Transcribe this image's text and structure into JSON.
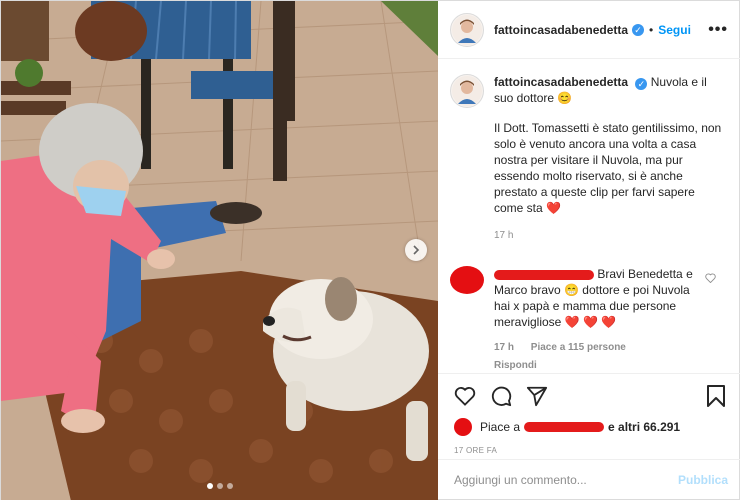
{
  "post": {
    "username": "fattoincasadabenedetta",
    "follow_label": "Segui",
    "more_label": "•••",
    "separator": "•"
  },
  "caption": {
    "username": "fattoincasadabenedetta",
    "title": "Nuvola e il suo dottore 😊",
    "text": "Il Dott. Tomassetti è stato gentilissimo, non solo è venuto ancora una volta a casa nostra per visitare il Nuvola, ma pur essendo molto riservato, si è anche prestato a queste clip per farvi sapere come sta ❤️",
    "time": "17 h"
  },
  "comment": {
    "text": "Bravi Benedetta e Marco bravo 😁 dottore e poi Nuvola hai x papà e mamma due persone meravigliose ❤️ ❤️ ❤️",
    "time": "17 h",
    "likes": "Piace a 115 persone",
    "reply": "Rispondi"
  },
  "likes": {
    "prefix": "Piace a",
    "suffix": "e altri 66.291"
  },
  "date": "17 ORE FA",
  "add_comment": {
    "placeholder": "Aggiungi un commento...",
    "publish_label": "Pubblica"
  },
  "carousel": {
    "count": 3,
    "active": 0
  },
  "colors": {
    "accent": "#0095f6",
    "verified": "#3897f0",
    "censor": "#e41b1b"
  }
}
